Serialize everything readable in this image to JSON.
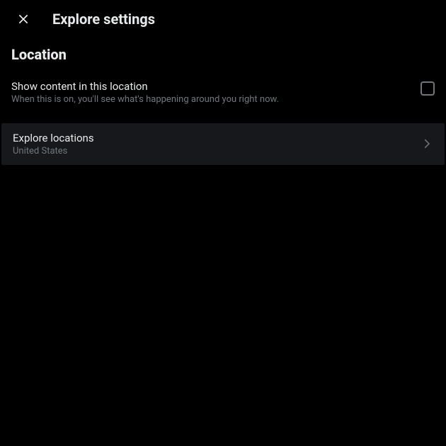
{
  "header": {
    "title": "Explore settings"
  },
  "section": {
    "title": "Location"
  },
  "setting": {
    "label": "Show content in this location",
    "description": "When this is on, you'll see what's happening around you right now."
  },
  "nav": {
    "label": "Explore locations",
    "sublabel": "United States"
  }
}
